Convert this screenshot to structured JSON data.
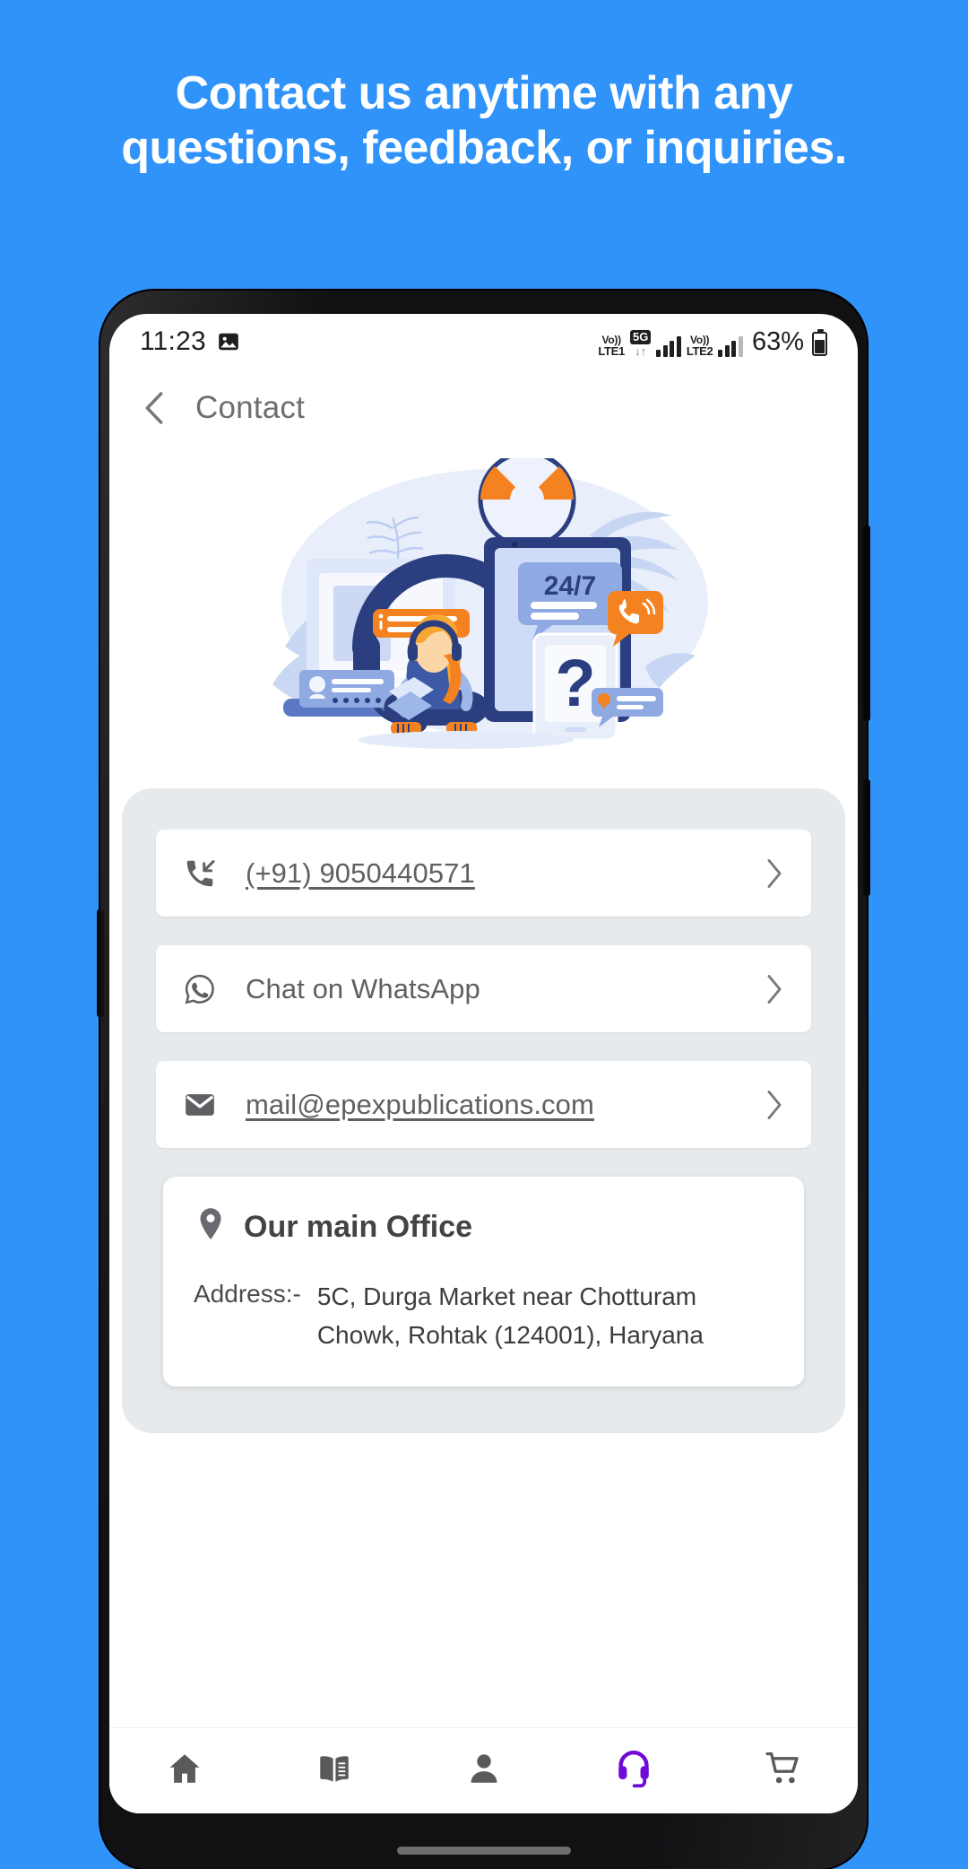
{
  "banner": {
    "line1": "Contact us anytime with any",
    "line2": "questions, feedback, or inquiries."
  },
  "colors": {
    "background_blue": "#2f93fa",
    "panel_gray": "#e7eaec",
    "card_white": "#ffffff",
    "text_gray": "#5f6064",
    "active_nav_purple": "#6f0ad8",
    "inactive_nav_gray": "#5a5a5d"
  },
  "status_bar": {
    "time": "11:23",
    "photo_icon": "image-icon",
    "sim1_volte": "Vo)) LTE1",
    "sim1_volte_top": "Vo))",
    "sim1_volte_bottom": "LTE1",
    "network_badge": "5G",
    "data_arrows": "↓↑",
    "sim2_volte_top": "Vo))",
    "sim2_volte_bottom": "LTE2",
    "battery_percent": "63%"
  },
  "app_bar": {
    "back_icon": "chevron-left-icon",
    "title": "Contact"
  },
  "hero": {
    "alt": "customer-support-illustration",
    "badge_text": "24/7"
  },
  "contact_rows": [
    {
      "icon": "call-received-icon",
      "label": "(+91) 9050440571",
      "underlined": true,
      "chevron": "chevron-right-icon"
    },
    {
      "icon": "whatsapp-icon",
      "label": "Chat on WhatsApp",
      "underlined": false,
      "chevron": "chevron-right-icon"
    },
    {
      "icon": "email-icon",
      "label": "mail@epexpublications.com",
      "underlined": true,
      "chevron": "chevron-right-icon"
    }
  ],
  "office": {
    "pin_icon": "location-pin-icon",
    "title": "Our main Office",
    "address_label": "Address:-",
    "address_value": "5C, Durga Market near Chotturam Chowk, Rohtak (124001), Haryana"
  },
  "bottom_nav": [
    {
      "icon": "home-icon",
      "name": "home",
      "active": false
    },
    {
      "icon": "book-icon",
      "name": "books",
      "active": false
    },
    {
      "icon": "person-icon",
      "name": "profile",
      "active": false
    },
    {
      "icon": "headset-icon",
      "name": "support",
      "active": true
    },
    {
      "icon": "cart-icon",
      "name": "cart",
      "active": false
    }
  ]
}
